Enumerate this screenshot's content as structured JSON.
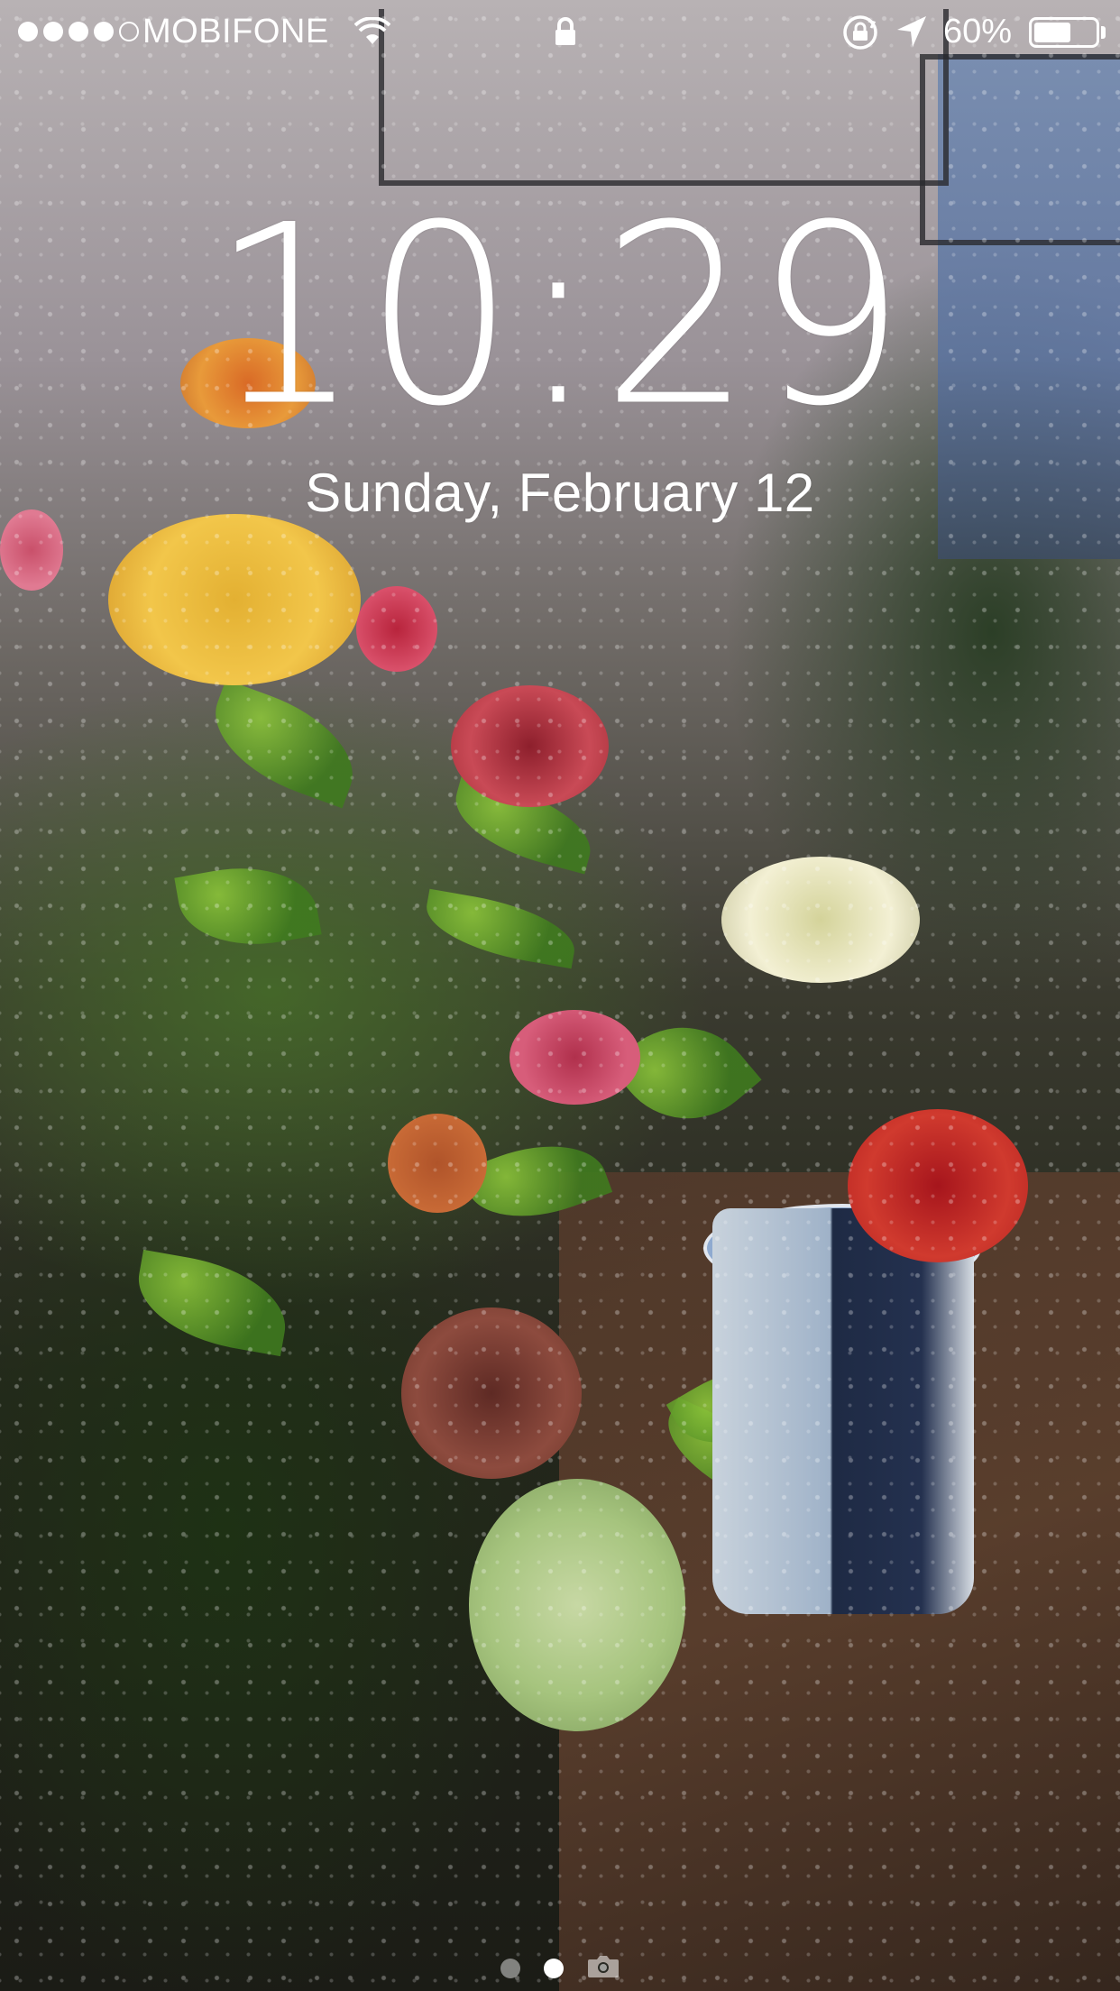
{
  "status_bar": {
    "signal_strength": 4,
    "signal_max": 5,
    "carrier": "MOBIFONE",
    "wifi_icon": "wifi-icon",
    "lock_icon": "lock-icon",
    "rotation_lock_icon": "rotation-lock-icon",
    "location_icon": "location-arrow-icon",
    "battery_percent_label": "60%",
    "battery_level": 0.6
  },
  "lock_screen": {
    "time": "10:29",
    "date": "Sunday, February 12"
  },
  "page_indicator": {
    "pages": 2,
    "active_page": 2,
    "camera_icon": "camera-icon"
  },
  "colors": {
    "text": "#ffffff"
  }
}
